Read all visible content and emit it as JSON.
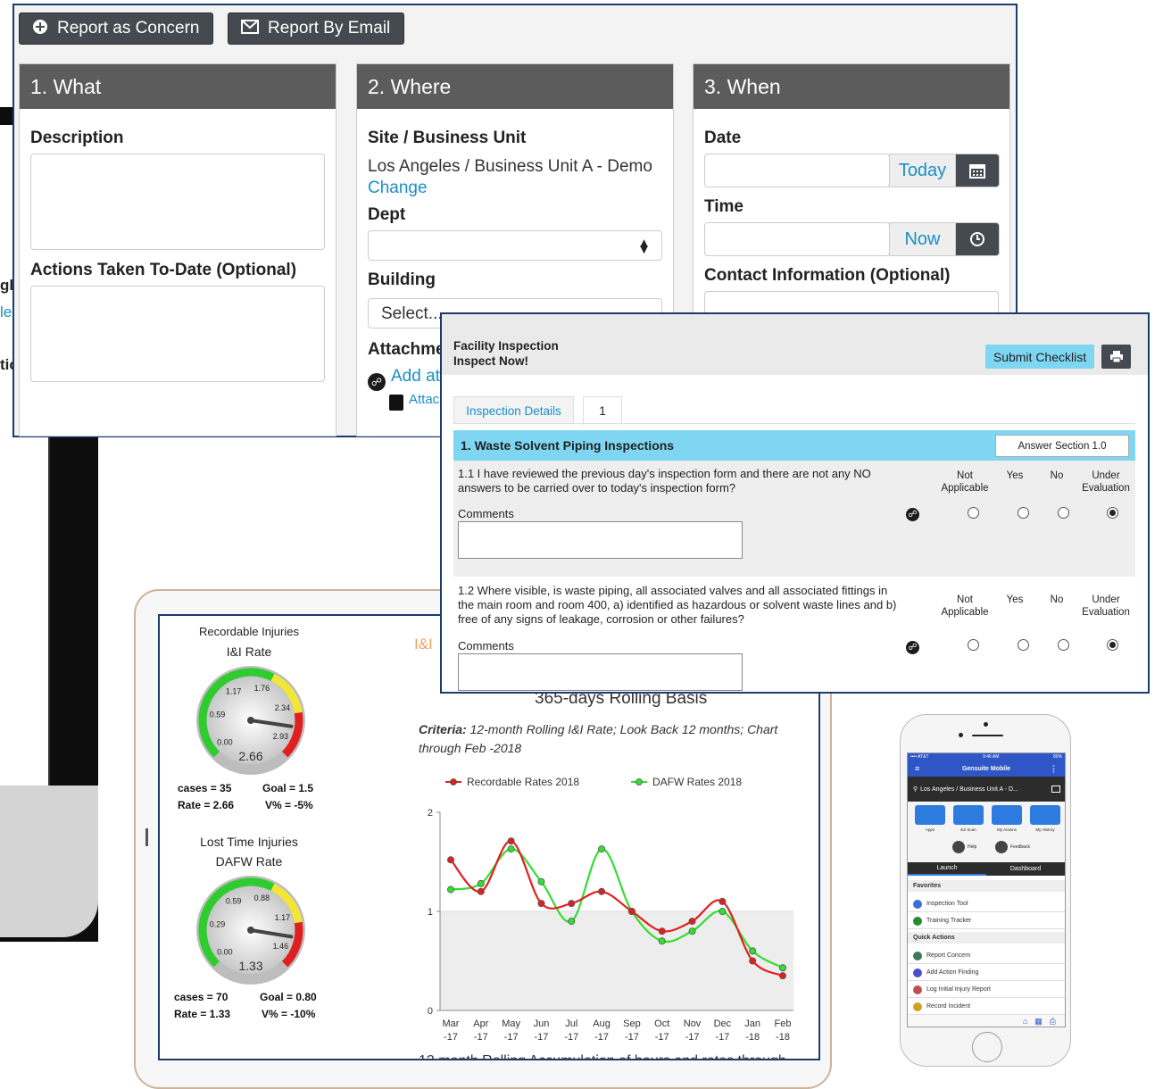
{
  "colors": {
    "panel_header": "#5c5c5c",
    "button_dark": "#444a4f",
    "link": "#1a8fc4",
    "insp_section": "#7fd6f2",
    "submit": "#7fd6f2",
    "frame": "#1a3b6e",
    "red": "#e02020",
    "green": "#33dd33"
  },
  "desktop_fragments": [
    "gl",
    "le",
    "tic"
  ],
  "concern": {
    "report_concern_label": "Report as Concern",
    "report_concern_icon": "plus-circle-icon",
    "report_email_label": "Report By Email",
    "report_email_icon": "envelope-icon",
    "what": {
      "title": "1. What",
      "description_label": "Description",
      "actions_label": "Actions Taken To-Date (Optional)"
    },
    "where": {
      "title": "2. Where",
      "site_label": "Site / Business Unit",
      "site_value": "Los Angeles / Business Unit A - Demo",
      "change_link": "Change",
      "dept_label": "Dept",
      "building_label": "Building",
      "building_placeholder": "Select...",
      "attachments_label": "Attachme",
      "add_attachment": "Add at",
      "attach_file": "Attac"
    },
    "when": {
      "title": "3. When",
      "date_label": "Date",
      "today_button": "Today",
      "time_label": "Time",
      "now_button": "Now",
      "contact_label": "Contact Information (Optional)"
    }
  },
  "inspection": {
    "title_line1": "Facility Inspection",
    "title_line2": "Inspect Now!",
    "submit_label": "Submit Checklist",
    "tabs": [
      "Inspection Details",
      "1"
    ],
    "section_title": "1. Waste Solvent Piping Inspections",
    "answer_section_label": "Answer Section 1.0",
    "columns": [
      "Not Applicable",
      "Yes",
      "No",
      "Under Evaluation"
    ],
    "questions": [
      {
        "text": "1.1 I have reviewed the previous day's inspection form and there are not any NO answers to be carried over to today's inspection form?",
        "comments_label": "Comments",
        "selected": "Under Evaluation"
      },
      {
        "text": "1.2 Where visible, is waste piping, all associated valves and all associated fittings in the main room and room 400, a) identified as hazardous or solvent waste lines and b) free of any signs of leakage, corrosion or other failures?",
        "comments_label": "Comments",
        "selected": "Under Evaluation"
      }
    ]
  },
  "dashboard": {
    "gauge1": {
      "title1": "Recordable Injuries",
      "title2": "I&I Rate",
      "ticks": [
        "0.00",
        "0.59",
        "1.17",
        "1.76",
        "2.34",
        "2.93"
      ],
      "value": 2.66,
      "value_label": "2.66",
      "max": 2.93,
      "cases": "cases = 35",
      "goal": "Goal = 1.5",
      "rate": "Rate = 2.66",
      "variance": "V% = -5%"
    },
    "gauge2": {
      "title1": "Lost Time Injuries",
      "title2": "DAFW Rate",
      "ticks": [
        "0.00",
        "0.29",
        "0.59",
        "0.88",
        "1.17",
        "1.46"
      ],
      "value": 1.33,
      "value_label": "1.33",
      "max": 1.46,
      "cases": "cases = 70",
      "goal": "Goal = 0.80",
      "rate": "Rate = 1.33",
      "variance": "V% = -10%"
    },
    "chart_tab_fragment": "I&I",
    "chart_subtitle": "365-days Rolling Basis",
    "criteria_label": "Criteria:",
    "criteria_text": " 12-month Rolling I&I Rate; Look Back 12 months; Chart through Feb -2018",
    "footer_fragment": "12 month Rolling Accumulation of hours and rates through"
  },
  "chart_data": {
    "type": "line",
    "categories": [
      "Mar -17",
      "Apr -17",
      "May -17",
      "Jun -17",
      "Jul -17",
      "Aug -17",
      "Sep -17",
      "Oct -17",
      "Nov -17",
      "Dec -17",
      "Jan -18",
      "Feb -18"
    ],
    "x_tick_top": [
      "Mar",
      "Apr",
      "May",
      "Jun",
      "Jul",
      "Aug",
      "Sep",
      "Oct",
      "Nov",
      "Dec",
      "Jan",
      "Feb"
    ],
    "x_tick_bottom": [
      "-17",
      "-17",
      "-17",
      "-17",
      "-17",
      "-17",
      "-17",
      "-17",
      "-17",
      "-17",
      "-18",
      "-18"
    ],
    "ylim": [
      0,
      2
    ],
    "yticks": [
      "0",
      "1",
      "2"
    ],
    "legend_position": "top",
    "series": [
      {
        "name": "Recordable Rates 2018",
        "color": "#e02020",
        "values": [
          1.52,
          1.2,
          1.71,
          1.08,
          1.08,
          1.2,
          1.0,
          0.8,
          0.9,
          1.1,
          0.5,
          0.35
        ]
      },
      {
        "name": "DAFW Rates 2018",
        "color": "#33dd33",
        "values": [
          1.22,
          1.28,
          1.63,
          1.3,
          0.9,
          1.63,
          1.0,
          0.7,
          0.8,
          1.0,
          0.6,
          0.43
        ]
      }
    ]
  },
  "phone": {
    "status_left": "•••• AT&T",
    "status_time": "9:46 AM",
    "status_right": "80%",
    "app_title": "Gensuite Mobile",
    "location": "Los Angeles / Business Unit A - D...",
    "quick_tiles": [
      "Apps",
      "EZ Scan",
      "My Actions",
      "My History"
    ],
    "help": "Help",
    "feedback": "Feedback",
    "tabs": [
      "Launch",
      "Dashboard"
    ],
    "favorites_header": "Favorites",
    "favorites": [
      "Inspection Tool",
      "Training Tracker"
    ],
    "quick_actions_header": "Quick Actions",
    "quick_actions": [
      "Report Concern",
      "Add Action Finding",
      "Log Initial Injury Report",
      "Record Incident"
    ]
  }
}
